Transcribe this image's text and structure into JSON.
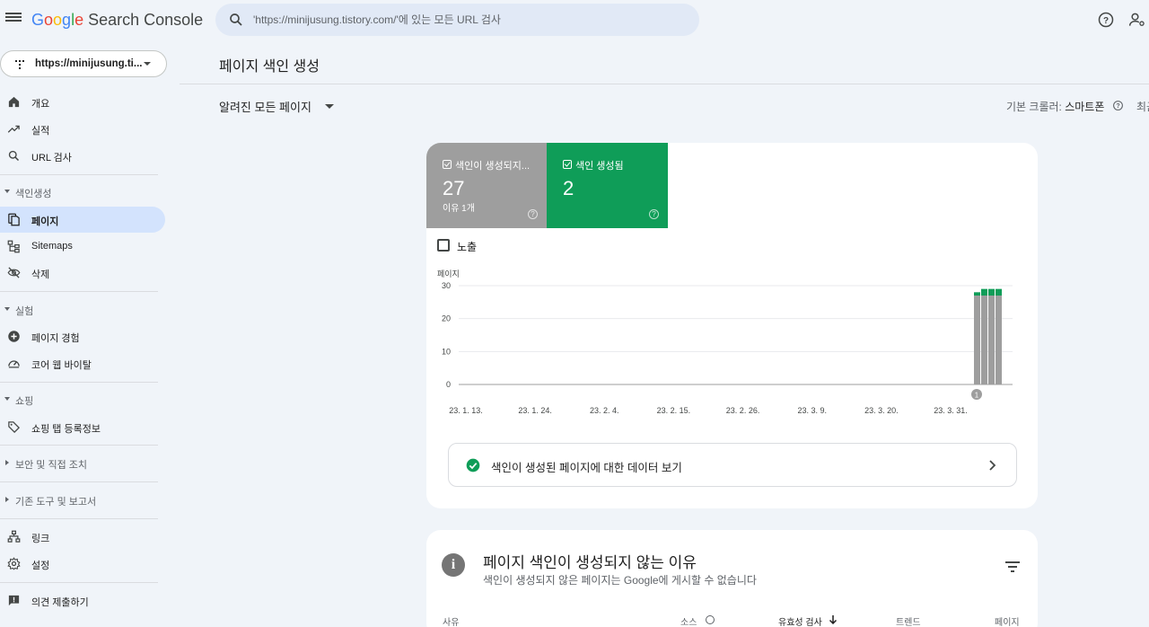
{
  "header": {
    "logo_google": "Google",
    "logo_rest": " Search Console",
    "search_placeholder": "'https://minijusung.tistory.com/'에 있는 모든 URL 검사"
  },
  "sidebar": {
    "property": "https://minijusung.ti...",
    "items_top": [
      {
        "label": "개요",
        "icon": "home-icon"
      },
      {
        "label": "실적",
        "icon": "trending-up-icon"
      },
      {
        "label": "URL 검사",
        "icon": "search-icon"
      }
    ],
    "section_index": "색인생성",
    "items_index": [
      {
        "label": "페이지",
        "icon": "pages-icon",
        "active": true
      },
      {
        "label": "Sitemaps",
        "icon": "sitemap-icon"
      },
      {
        "label": "삭제",
        "icon": "visibility-off-icon"
      }
    ],
    "section_experience": "실험",
    "items_experience": [
      {
        "label": "페이지 경험",
        "icon": "add-circle-icon"
      },
      {
        "label": "코어 웹 바이탈",
        "icon": "speed-icon"
      }
    ],
    "section_shopping": "쇼핑",
    "items_shopping": [
      {
        "label": "쇼핑 탭 등록정보",
        "icon": "tag-icon"
      }
    ],
    "section_security": "보안 및 직접 조치",
    "section_legacy": "기존 도구 및 보고서",
    "items_bottom": [
      {
        "label": "링크",
        "icon": "links-icon"
      },
      {
        "label": "설정",
        "icon": "settings-icon"
      }
    ],
    "feedback": "의견 제출하기"
  },
  "main": {
    "page_title": "페이지 색인 생성",
    "filter": "알려진 모든 페이지",
    "crawler_label": "기본 크롤러: ",
    "crawler_value": "스마트폰",
    "crawler_more": "최근"
  },
  "summary": {
    "not_indexed": {
      "label": "색인이 생성되지...",
      "value": "27",
      "sub": "이유 1개"
    },
    "indexed": {
      "label": "색인 생성됨",
      "value": "2"
    },
    "impressions_label": "노출",
    "colors": {
      "not_indexed": "#9e9e9e",
      "indexed": "#0f9d58"
    }
  },
  "chart_data": {
    "type": "bar",
    "ylabel": "페이지",
    "ylim": [
      0,
      30
    ],
    "yticks": [
      0,
      10,
      20,
      30
    ],
    "xticks": [
      "23. 1. 13.",
      "23. 1. 24.",
      "23. 2. 4.",
      "23. 2. 15.",
      "23. 2. 26.",
      "23. 3. 9.",
      "23. 3. 20.",
      "23. 3. 31."
    ],
    "stacked": true,
    "annotation": "1",
    "series": [
      {
        "name": "색인이 생성되지 않음",
        "color": "#9e9e9e",
        "values": [
          27,
          27,
          27,
          27
        ]
      },
      {
        "name": "색인 생성됨",
        "color": "#0f9d58",
        "values": [
          1,
          2,
          2,
          2
        ]
      }
    ]
  },
  "link_row": {
    "label": "색인이 생성된 페이지에 대한 데이터 보기"
  },
  "reasons": {
    "title": "페이지 색인이 생성되지 않는 이유",
    "subtitle": "색인이 생성되지 않은 페이지는 Google에 게시할 수 없습니다",
    "columns": [
      "사유",
      "소스",
      "유효성 검사",
      "트렌드",
      "페이지"
    ]
  }
}
